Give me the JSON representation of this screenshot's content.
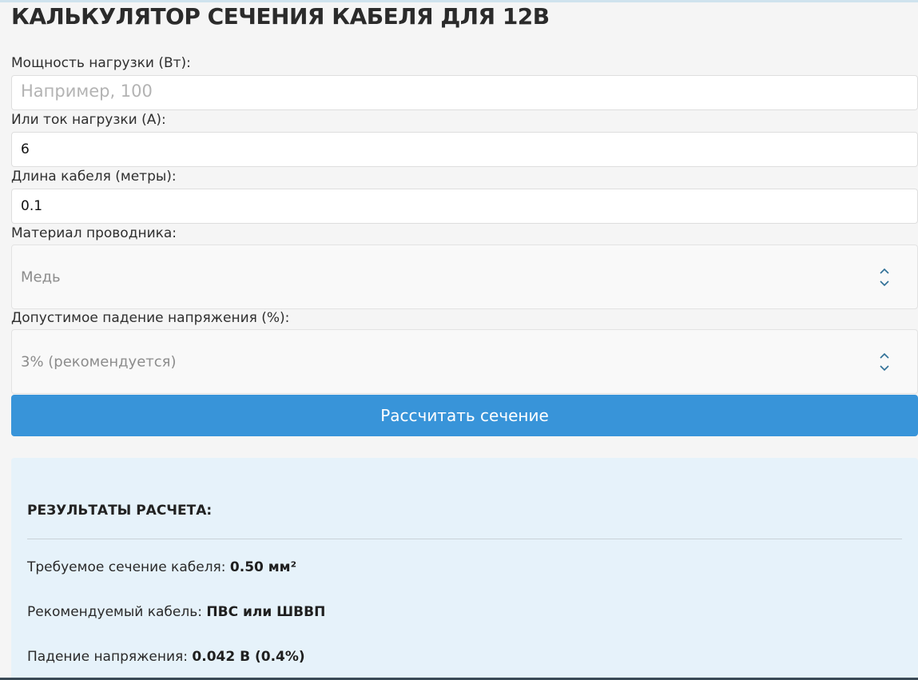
{
  "title": "КАЛЬКУЛЯТОР СЕЧЕНИЯ КАБЕЛЯ ДЛЯ 12В",
  "power": {
    "label": "Мощность нагрузки (Вт):",
    "placeholder": "Например, 100",
    "value": ""
  },
  "current": {
    "label": "Или ток нагрузки (А):",
    "value": "6"
  },
  "length": {
    "label": "Длина кабеля (метры):",
    "value": "0.1"
  },
  "material": {
    "label": "Материал проводника:",
    "selected": "Медь"
  },
  "voltage_drop": {
    "label": "Допустимое падение напряжения (%):",
    "selected": "3% (рекомендуется)"
  },
  "calculate_button": "Рассчитать сечение",
  "results": {
    "heading": "РЕЗУЛЬТАТЫ РАСЧЕТА:",
    "cross_section_label": "Требуемое сечение кабеля: ",
    "cross_section_value": "0.50 мм²",
    "cable_label": "Рекомендуемый кабель: ",
    "cable_value": "ПВС или ШВВП",
    "drop_label": "Падение напряжения: ",
    "drop_value": "0.042 В (0.4%)"
  },
  "colors": {
    "button": "#3894d9",
    "results_background": "#e6f2fa",
    "select_arrows": "#2e6f96"
  }
}
